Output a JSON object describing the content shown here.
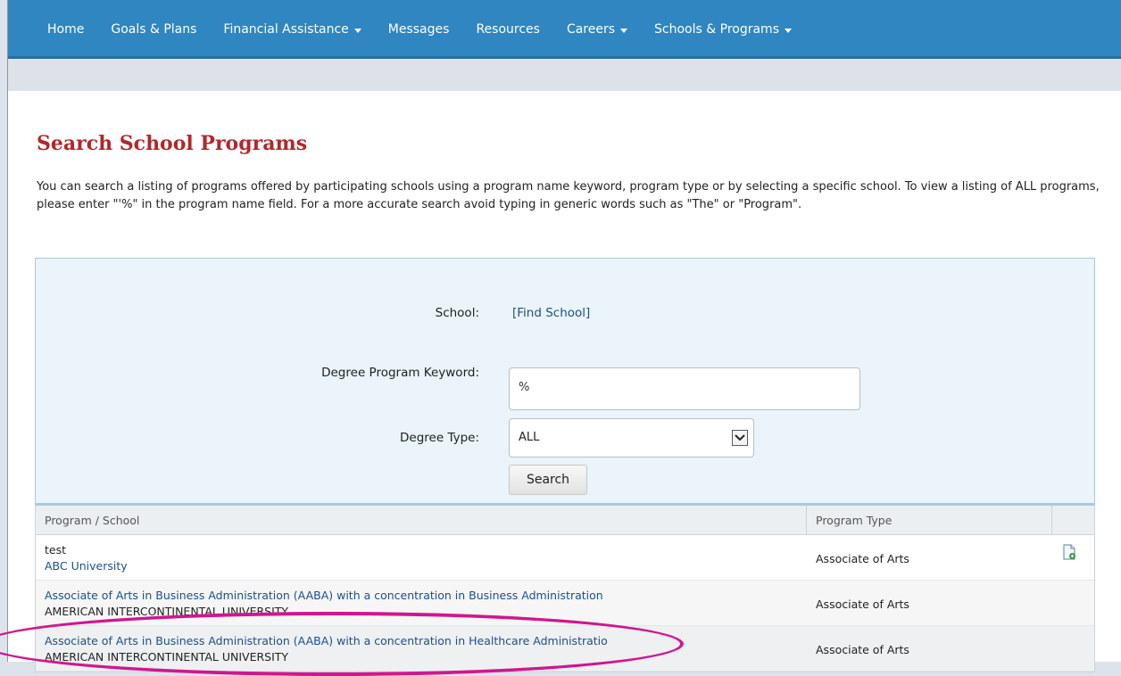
{
  "nav": {
    "items": [
      {
        "label": "Home",
        "dropdown": false
      },
      {
        "label": "Goals & Plans",
        "dropdown": false
      },
      {
        "label": "Financial Assistance",
        "dropdown": true
      },
      {
        "label": "Messages",
        "dropdown": false
      },
      {
        "label": "Resources",
        "dropdown": false
      },
      {
        "label": "Careers",
        "dropdown": true
      },
      {
        "label": "Schools & Programs",
        "dropdown": true
      }
    ]
  },
  "page": {
    "title": "Search School Programs",
    "intro": "You can search a listing of programs offered by participating schools using a program name keyword, program type or by selecting a specific school. To view a listing of ALL programs, please enter \"'%\" in the program name field. For a more accurate search avoid typing in generic words such as \"The\" or \"Program\"."
  },
  "search": {
    "school_label": "School:",
    "find_school": "[Find School]",
    "keyword_label": "Degree Program Keyword:",
    "keyword_value": "%",
    "degree_type_label": "Degree Type:",
    "degree_type_value": "ALL",
    "search_button": "Search"
  },
  "results": {
    "columns": {
      "program": "Program / School",
      "type": "Program Type"
    },
    "rows": [
      {
        "program": "test",
        "school": "ABC University",
        "type": "Associate of Arts"
      },
      {
        "program": "Associate of Arts in Business Administration (AABA) with a concentration in Business Administration",
        "school": "AMERICAN INTERCONTINENTAL UNIVERSITY",
        "type": "Associate of Arts"
      },
      {
        "program": "Associate of Arts in Business Administration (AABA) with a concentration in Healthcare Administratio",
        "school": "AMERICAN INTERCONTINENTAL UNIVERSITY",
        "type": "Associate of Arts"
      }
    ]
  },
  "colors": {
    "nav": "#2f86c0",
    "title": "#b0282c",
    "link": "#1d4f8a",
    "highlight": "#d1168f"
  }
}
